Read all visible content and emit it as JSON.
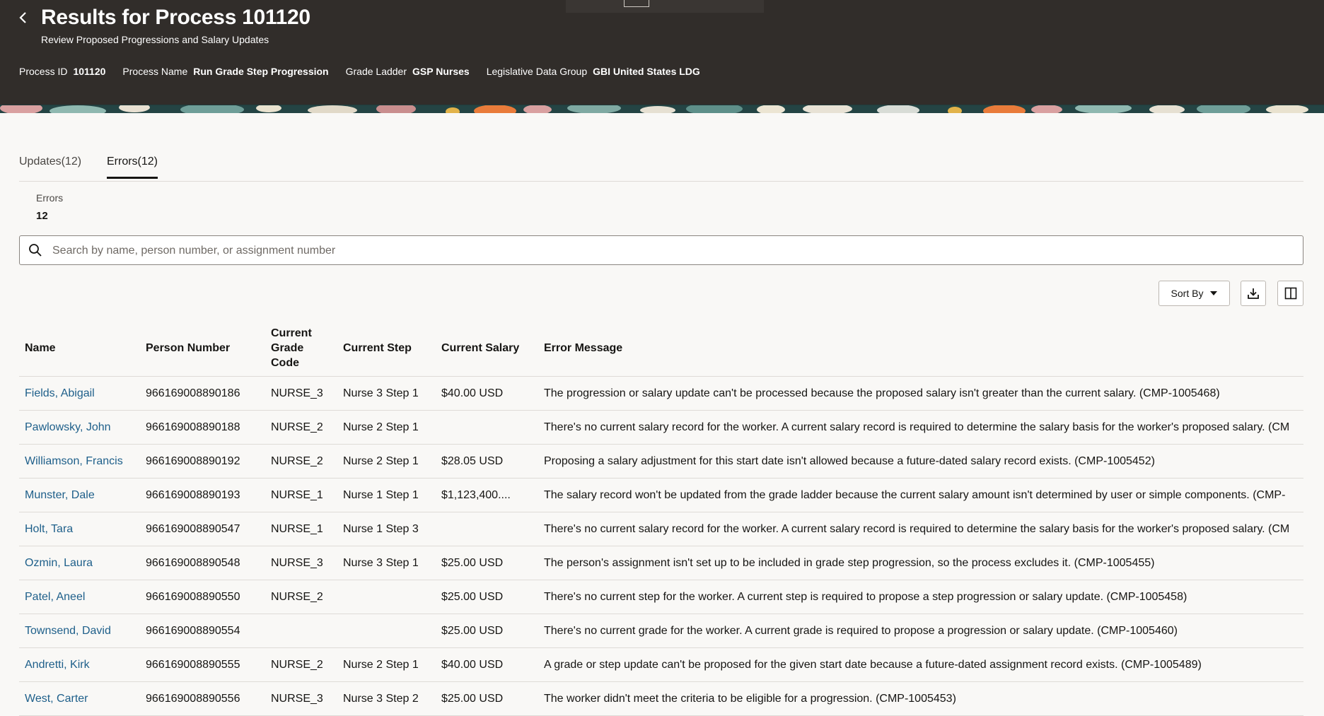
{
  "header": {
    "title": "Results for Process 101120",
    "subtitle": "Review Proposed Progressions and Salary Updates",
    "meta": [
      {
        "label": "Process ID",
        "value": "101120"
      },
      {
        "label": "Process Name",
        "value": "Run Grade Step Progression"
      },
      {
        "label": "Grade Ladder",
        "value": "GSP Nurses"
      },
      {
        "label": "Legislative Data Group",
        "value": "GBI United States LDG"
      }
    ]
  },
  "tabs": [
    {
      "label": "Updates(12)",
      "active": false
    },
    {
      "label": "Errors(12)",
      "active": true
    }
  ],
  "summary": {
    "label": "Errors",
    "value": "12"
  },
  "search": {
    "placeholder": "Search by name, person number, or assignment number",
    "value": ""
  },
  "toolbar": {
    "sort_label": "Sort By"
  },
  "table": {
    "columns": [
      "Name",
      "Person Number",
      "Current Grade Code",
      "Current Step",
      "Current Salary",
      "Error Message"
    ],
    "rows": [
      {
        "name": "Fields, Abigail",
        "person_number": "966169008890186",
        "grade": "NURSE_3",
        "step": "Nurse 3 Step 1",
        "salary": "$40.00 USD",
        "error": "The progression or salary update can't be processed because the proposed salary isn't greater than the current salary. (CMP-1005468)"
      },
      {
        "name": "Pawlowsky, John",
        "person_number": "966169008890188",
        "grade": "NURSE_2",
        "step": "Nurse 2 Step 1",
        "salary": "",
        "error": "There's no current salary record for the worker. A current salary record is required to determine the salary basis for the worker's proposed salary. (CM"
      },
      {
        "name": "Williamson, Francis",
        "person_number": "966169008890192",
        "grade": "NURSE_2",
        "step": "Nurse 2 Step 1",
        "salary": "$28.05 USD",
        "error": "Proposing a salary adjustment for this start date isn't allowed because a future-dated salary record exists. (CMP-1005452)"
      },
      {
        "name": "Munster, Dale",
        "person_number": "966169008890193",
        "grade": "NURSE_1",
        "step": "Nurse 1 Step 1",
        "salary": "$1,123,400....",
        "error": "The salary record won't be updated from the grade ladder because the current salary amount isn't determined by user or simple components. (CMP-"
      },
      {
        "name": "Holt, Tara",
        "person_number": "966169008890547",
        "grade": "NURSE_1",
        "step": "Nurse 1 Step 3",
        "salary": "",
        "error": "There's no current salary record for the worker. A current salary record is required to determine the salary basis for the worker's proposed salary. (CM"
      },
      {
        "name": "Ozmin, Laura",
        "person_number": "966169008890548",
        "grade": "NURSE_3",
        "step": "Nurse 3 Step 1",
        "salary": "$25.00 USD",
        "error": "The person's assignment isn't set up to be included in grade step progression, so the process excludes it. (CMP-1005455)"
      },
      {
        "name": "Patel, Aneel",
        "person_number": "966169008890550",
        "grade": "NURSE_2",
        "step": "",
        "salary": "$25.00 USD",
        "error": "There's no current step for the worker. A current step is required to propose a step progression or salary update. (CMP-1005458)"
      },
      {
        "name": "Townsend, David",
        "person_number": "966169008890554",
        "grade": "",
        "step": "",
        "salary": "$25.00 USD",
        "error": "There's no current grade for the worker. A current grade is required to propose a progression or salary update. (CMP-1005460)"
      },
      {
        "name": "Andretti, Kirk",
        "person_number": "966169008890555",
        "grade": "NURSE_2",
        "step": "Nurse 2 Step 1",
        "salary": "$40.00 USD",
        "error": "A grade or step update can't be proposed for the given start date because a future-dated assignment record exists. (CMP-1005489)"
      },
      {
        "name": "West, Carter",
        "person_number": "966169008890556",
        "grade": "NURSE_3",
        "step": "Nurse 3 Step 2",
        "salary": "$25.00 USD",
        "error": "The worker didn't meet the criteria to be eligible for a progression. (CMP-1005453)"
      }
    ]
  },
  "icons": {
    "back": "chevron-left-icon",
    "search": "search-icon",
    "sort_caret": "caret-down-icon",
    "download": "download-icon",
    "columns": "columns-icon"
  },
  "colors": {
    "header_bg": "#312d2a",
    "link": "#1e5f8a",
    "page_bg": "#f9f8f6"
  }
}
